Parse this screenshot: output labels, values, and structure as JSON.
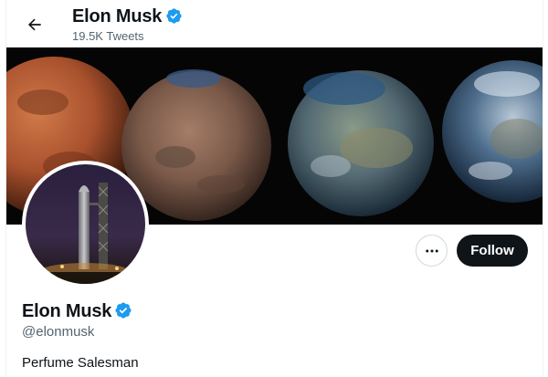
{
  "header": {
    "name": "Elon Musk",
    "tweet_count": "19.5K Tweets"
  },
  "profile": {
    "name": "Elon Musk",
    "handle": "@elonmusk",
    "bio": "Perfume Salesman",
    "follow_label": "Follow",
    "more_label": "•••"
  },
  "colors": {
    "verified_blue": "#1d9bf0",
    "follow_bg": "#0f1419",
    "secondary_text": "#536471"
  },
  "icons": {
    "back": "arrow-left-icon",
    "verified": "verified-badge-icon",
    "more": "more-horizontal-icon"
  }
}
